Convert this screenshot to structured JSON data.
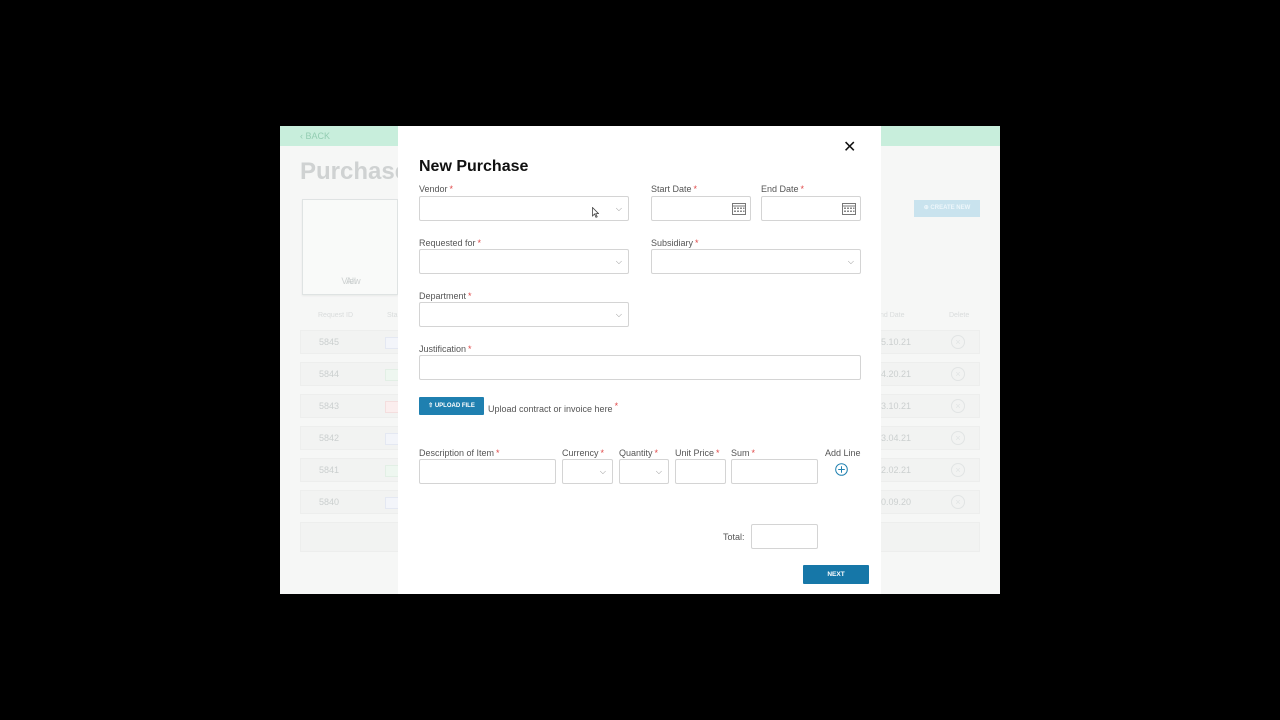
{
  "background": {
    "back_label": "BACK",
    "page_title": "Purchase",
    "view_all_line1": "View",
    "view_all_line2": "All",
    "create_new_label": "CREATE NEW",
    "columns": {
      "request_id": "Request ID",
      "status": "Sta",
      "end_date": "nd Date",
      "delete": "Delete"
    },
    "rows": [
      {
        "id": "5845",
        "date": "5.10.21"
      },
      {
        "id": "5844",
        "date": "4.20.21"
      },
      {
        "id": "5843",
        "date": "3.10.21"
      },
      {
        "id": "5842",
        "date": "3.04.21"
      },
      {
        "id": "5841",
        "date": "2.02.21"
      },
      {
        "id": "5840",
        "date": "0.09.20"
      }
    ]
  },
  "modal": {
    "title": "New Purchase",
    "close_icon": "close-icon",
    "required_mark": "*",
    "fields": {
      "vendor": {
        "label": "Vendor",
        "value": ""
      },
      "start_date": {
        "label": "Start Date",
        "value": ""
      },
      "end_date": {
        "label": "End Date",
        "value": ""
      },
      "requested_for": {
        "label": "Requested for",
        "value": ""
      },
      "subsidiary": {
        "label": "Subsidiary",
        "value": ""
      },
      "department": {
        "label": "Department",
        "value": ""
      },
      "justification": {
        "label": "Justification",
        "value": ""
      }
    },
    "upload": {
      "button_label": "UPLOAD FILE",
      "hint": "Upload contract or invoice here"
    },
    "line_items": {
      "description_label": "Description of Item",
      "currency_label": "Currency",
      "quantity_label": "Quantity",
      "unit_price_label": "Unit Price",
      "sum_label": "Sum",
      "add_line_label": "Add Line"
    },
    "total_label": "Total:",
    "total_value": "",
    "next_label": "NEXT"
  },
  "colors": {
    "primary": "#1677a8",
    "required": "#e04848",
    "topbar": "#c8eedc"
  }
}
